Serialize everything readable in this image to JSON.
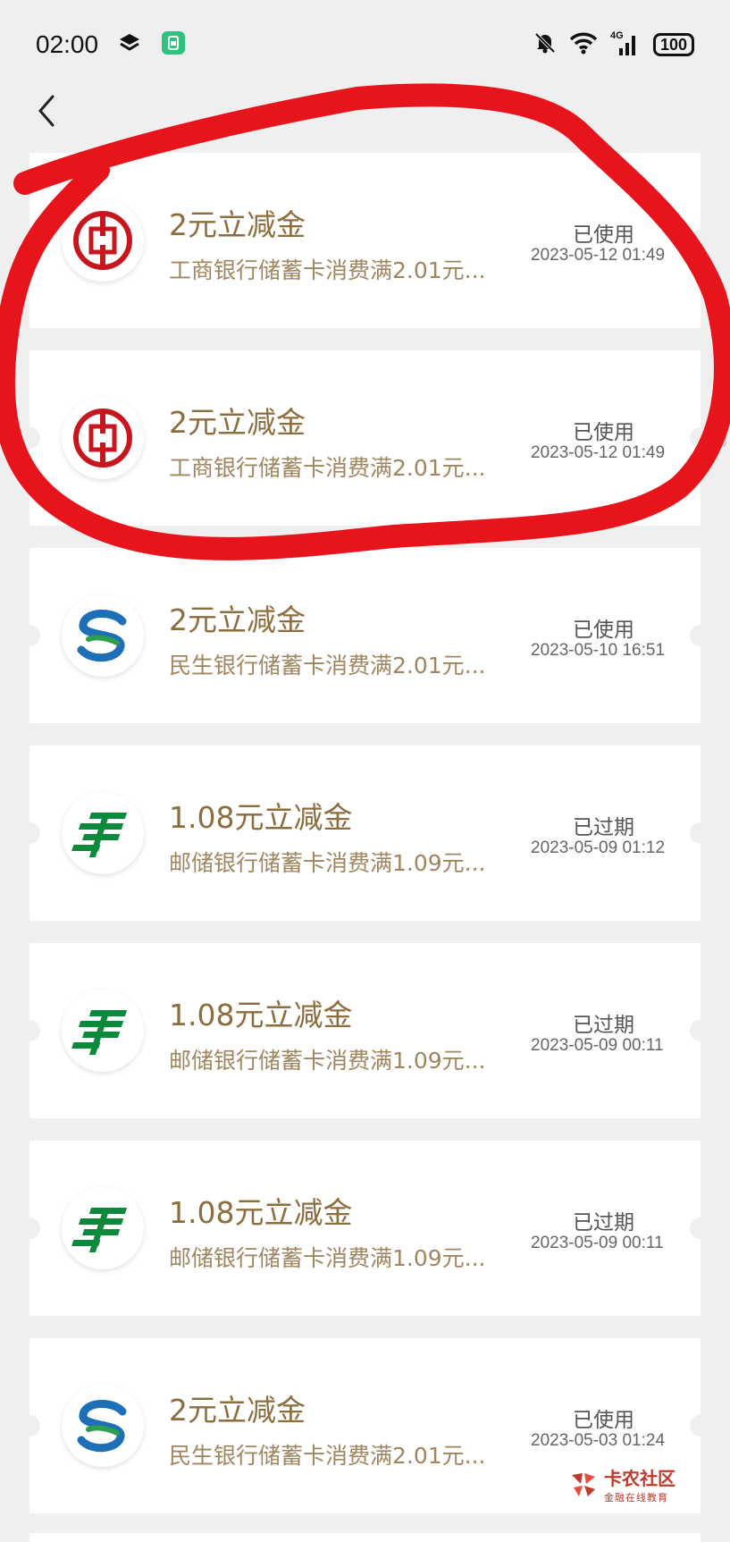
{
  "status_bar": {
    "time": "02:00",
    "signal_label": "4G",
    "battery": "100"
  },
  "coupons": [
    {
      "title": "2元立减金",
      "desc": "工商银行储蓄卡消费满2.01元...",
      "status": "已使用",
      "time": "2023-05-12 01:49",
      "bank_icon": "icbc-logo-icon"
    },
    {
      "title": "2元立减金",
      "desc": "工商银行储蓄卡消费满2.01元...",
      "status": "已使用",
      "time": "2023-05-12 01:49",
      "bank_icon": "icbc-logo-icon"
    },
    {
      "title": "2元立减金",
      "desc": "民生银行储蓄卡消费满2.01元...",
      "status": "已使用",
      "time": "2023-05-10 16:51",
      "bank_icon": "cmbc-logo-icon"
    },
    {
      "title": "1.08元立减金",
      "desc": "邮储银行储蓄卡消费满1.09元...",
      "status": "已过期",
      "time": "2023-05-09 01:12",
      "bank_icon": "psbc-logo-icon"
    },
    {
      "title": "1.08元立减金",
      "desc": "邮储银行储蓄卡消费满1.09元...",
      "status": "已过期",
      "time": "2023-05-09 00:11",
      "bank_icon": "psbc-logo-icon"
    },
    {
      "title": "1.08元立减金",
      "desc": "邮储银行储蓄卡消费满1.09元...",
      "status": "已过期",
      "time": "2023-05-09 00:11",
      "bank_icon": "psbc-logo-icon"
    },
    {
      "title": "2元立减金",
      "desc": "民生银行储蓄卡消费满2.01元...",
      "status": "已使用",
      "time": "2023-05-03 01:24",
      "bank_icon": "cmbc-logo-icon"
    }
  ],
  "watermark": {
    "main": "卡农社区",
    "sub": "金融在线教育"
  },
  "colors": {
    "title": "#8c6d3e",
    "annotation": "#e8141c",
    "icbc": "#c7161e",
    "cmbc_blue": "#1d6fb8",
    "cmbc_green": "#2e9e4f",
    "psbc": "#0a8a3a"
  }
}
